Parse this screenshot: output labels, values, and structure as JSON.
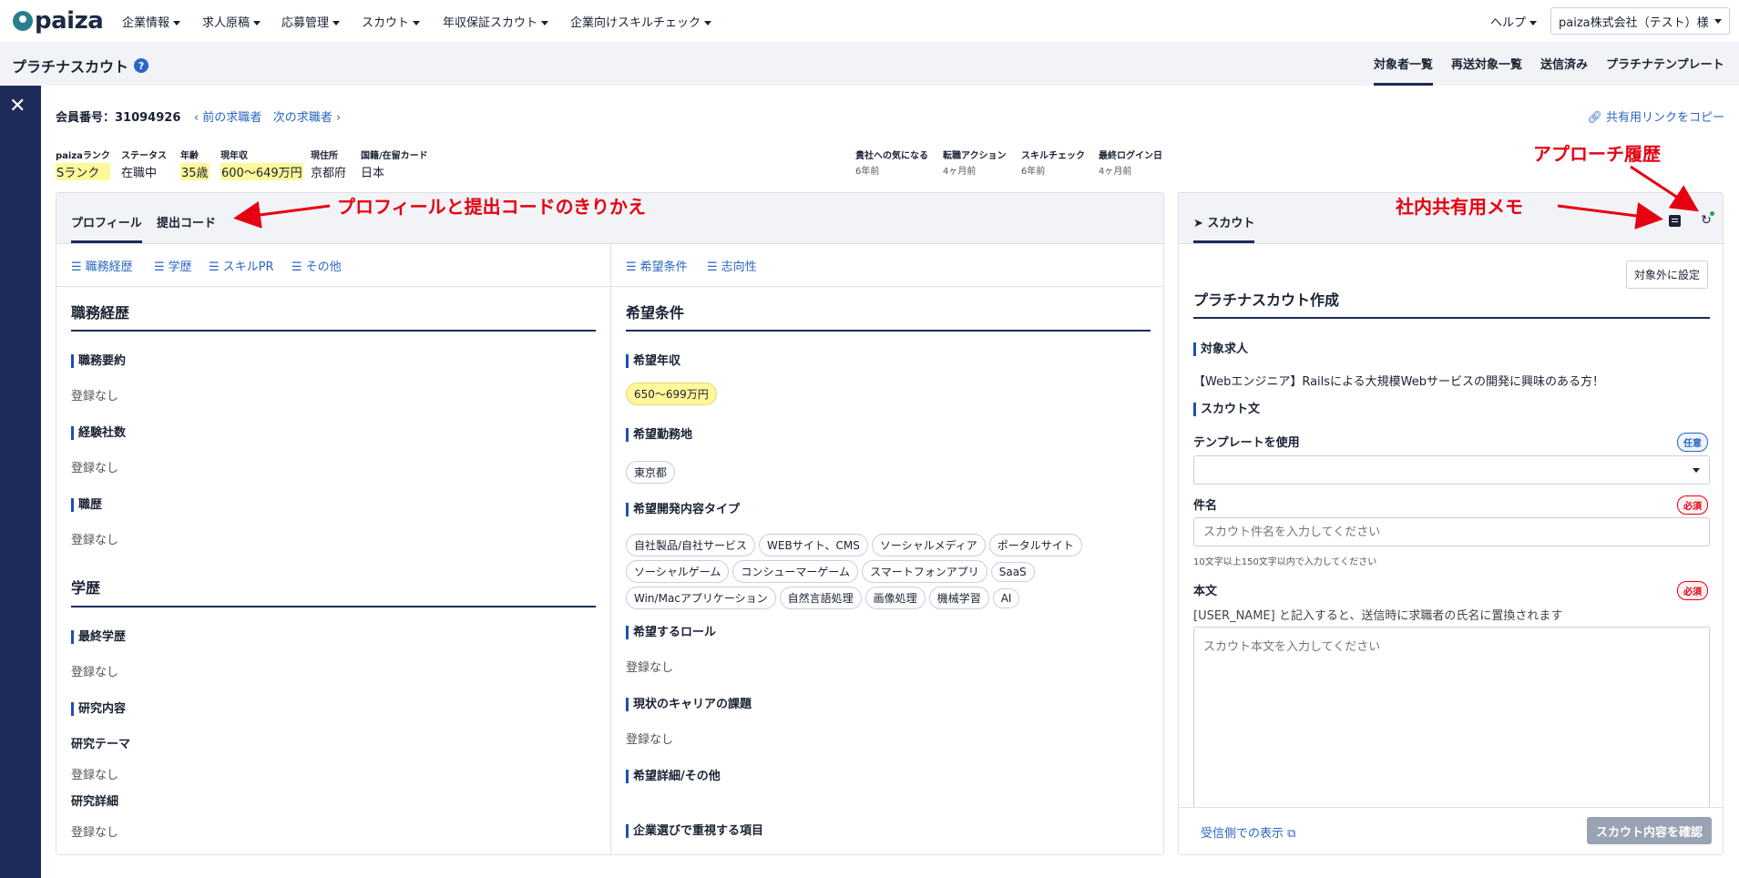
{
  "topnav": {
    "logo": "paiza",
    "items": [
      "企業情報",
      "求人原稿",
      "応募管理",
      "スカウト",
      "年収保証スカウト",
      "企業向けスキルチェック"
    ],
    "help": "ヘルプ",
    "account": "paiza株式会社（テスト）様"
  },
  "subheader": {
    "title": "プラチナスカウト",
    "tabs": [
      "対象者一覧",
      "再送対象一覧",
      "送信済み",
      "プラチナテンプレート"
    ]
  },
  "member": {
    "number_label": "会員番号：31094926",
    "prev": "前の求職者",
    "next": "次の求職者",
    "share_link": "共有用リンクをコピー"
  },
  "info": {
    "rank_label": "paizaランク",
    "rank": "Sランク",
    "status_label": "ステータス",
    "status": "在職中",
    "age_label": "年齢",
    "age": "35歳",
    "income_label": "現年収",
    "income": "600〜649万円",
    "address_label": "現住所",
    "address": "京都府",
    "nation_label": "国籍/在留カード",
    "nation": "日本",
    "interest_label": "貴社への気になる",
    "interest": "6年前",
    "action_label": "転職アクション",
    "action": "4ヶ月前",
    "skill_label": "スキルチェック",
    "skill": "6年前",
    "login_label": "最終ログイン日",
    "login": "4ヶ月前"
  },
  "annotations": {
    "history": "アプローチ履歴",
    "toggle": "プロフィールと提出コードのきりかえ",
    "memo": "社内共有用メモ"
  },
  "profile": {
    "tabs": [
      "プロフィール",
      "提出コード"
    ],
    "left_nav": [
      "職務経歴",
      "学歴",
      "スキルPR",
      "その他"
    ],
    "right_nav": [
      "希望条件",
      "志向性"
    ],
    "career": {
      "title": "職務経歴",
      "summary_label": "職務要約",
      "summary": "登録なし",
      "companies_label": "経験社数",
      "companies": "登録なし",
      "history_label": "職歴",
      "history": "登録なし"
    },
    "education": {
      "title": "学歴",
      "final_label": "最終学歴",
      "final": "登録なし",
      "research_label": "研究内容",
      "theme_label": "研究テーマ",
      "theme": "登録なし",
      "detail_label": "研究詳細",
      "detail": "登録なし"
    },
    "wish": {
      "title": "希望条件",
      "income_label": "希望年収",
      "income": "650〜699万円",
      "location_label": "希望勤務地",
      "location": "東京都",
      "dev_label": "希望開発内容タイプ",
      "dev_types": [
        "自社製品/自社サービス",
        "WEBサイト、CMS",
        "ソーシャルメディア",
        "ポータルサイト",
        "ソーシャルゲーム",
        "コンシューマーゲーム",
        "スマートフォンアプリ",
        "SaaS",
        "Win/Macアプリケーション",
        "自然言語処理",
        "画像処理",
        "機械学習",
        "AI"
      ],
      "role_label": "希望するロール",
      "role": "登録なし",
      "issue_label": "現状のキャリアの課題",
      "issue": "登録なし",
      "other_label": "希望詳細/その他",
      "priority_label": "企業選びで重視する項目"
    }
  },
  "scout": {
    "tab": "スカウト",
    "exclude_btn": "対象外に設定",
    "title": "プラチナスカウト作成",
    "job_label": "対象求人",
    "job": "【Webエンジニア】Railsによる大規模Webサービスの開発に興味のある方！",
    "text_label": "スカウト文",
    "template_label": "テンプレートを使用",
    "template_badge": "任意",
    "subject_label": "件名",
    "subject_badge": "必須",
    "subject_placeholder": "スカウト件名を入力してください",
    "subject_hint": "10文字以上150文字以内で入力してください",
    "body_label": "本文",
    "body_badge": "必須",
    "body_note": "[USER_NAME] と記入すると、送信時に求職者の氏名に置換されます",
    "body_placeholder": "スカウト本文を入力してください",
    "preview_link": "受信側での表示",
    "confirm_btn": "スカウト内容を確認"
  },
  "colors": {
    "navy": "#1d2a5a",
    "link": "#2a66c4",
    "annotation": "#e60012",
    "highlight": "#fff89a"
  }
}
